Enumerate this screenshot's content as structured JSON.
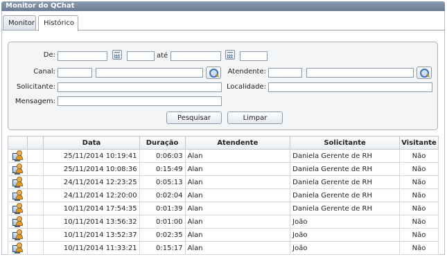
{
  "window": {
    "title": "Monitor do QChat"
  },
  "tabs": [
    {
      "label": "Monitor",
      "active": false
    },
    {
      "label": "Histórico",
      "active": true
    }
  ],
  "filters": {
    "de_label": "De:",
    "ate_label": "até",
    "canal_label": "Canal:",
    "atendente_label": "Atendente:",
    "solicitante_label": "Solicitante:",
    "localidade_label": "Localidade:",
    "mensagem_label": "Mensagem:",
    "pesquisar_label": "Pesquisar",
    "limpar_label": "Limpar"
  },
  "table": {
    "headers": [
      "",
      "",
      "Data",
      "Duração",
      "Atendente",
      "Solicitante",
      "Visitante"
    ],
    "rows": [
      {
        "data": "25/11/2014 10:19:41",
        "duracao": "0:06:03",
        "atendente": "Alan",
        "solicitante": "Daniela Gerente de RH",
        "visitante": "Não"
      },
      {
        "data": "25/11/2014 10:08:36",
        "duracao": "0:15:49",
        "atendente": "Alan",
        "solicitante": "Daniela Gerente de RH",
        "visitante": "Não"
      },
      {
        "data": "24/11/2014 12:23:25",
        "duracao": "0:05:13",
        "atendente": "Alan",
        "solicitante": "Daniela Gerente de RH",
        "visitante": "Não"
      },
      {
        "data": "24/11/2014 12:20:00",
        "duracao": "0:02:04",
        "atendente": "Alan",
        "solicitante": "Daniela Gerente de RH",
        "visitante": "Não"
      },
      {
        "data": "10/11/2014 17:54:35",
        "duracao": "0:01:39",
        "atendente": "Alan",
        "solicitante": "Daniela Gerente de RH",
        "visitante": "Não"
      },
      {
        "data": "10/11/2014 13:56:32",
        "duracao": "0:01:00",
        "atendente": "Alan",
        "solicitante": "João",
        "visitante": "Não"
      },
      {
        "data": "10/11/2014 13:52:37",
        "duracao": "0:02:35",
        "atendente": "Alan",
        "solicitante": "João",
        "visitante": "Não"
      },
      {
        "data": "10/11/2014 11:33:21",
        "duracao": "0:15:17",
        "atendente": "Alan",
        "solicitante": "João",
        "visitante": "Não"
      }
    ]
  },
  "icons": {
    "calendar": "calendar-icon",
    "search": "search-icon",
    "row": "chat-user-icon"
  }
}
